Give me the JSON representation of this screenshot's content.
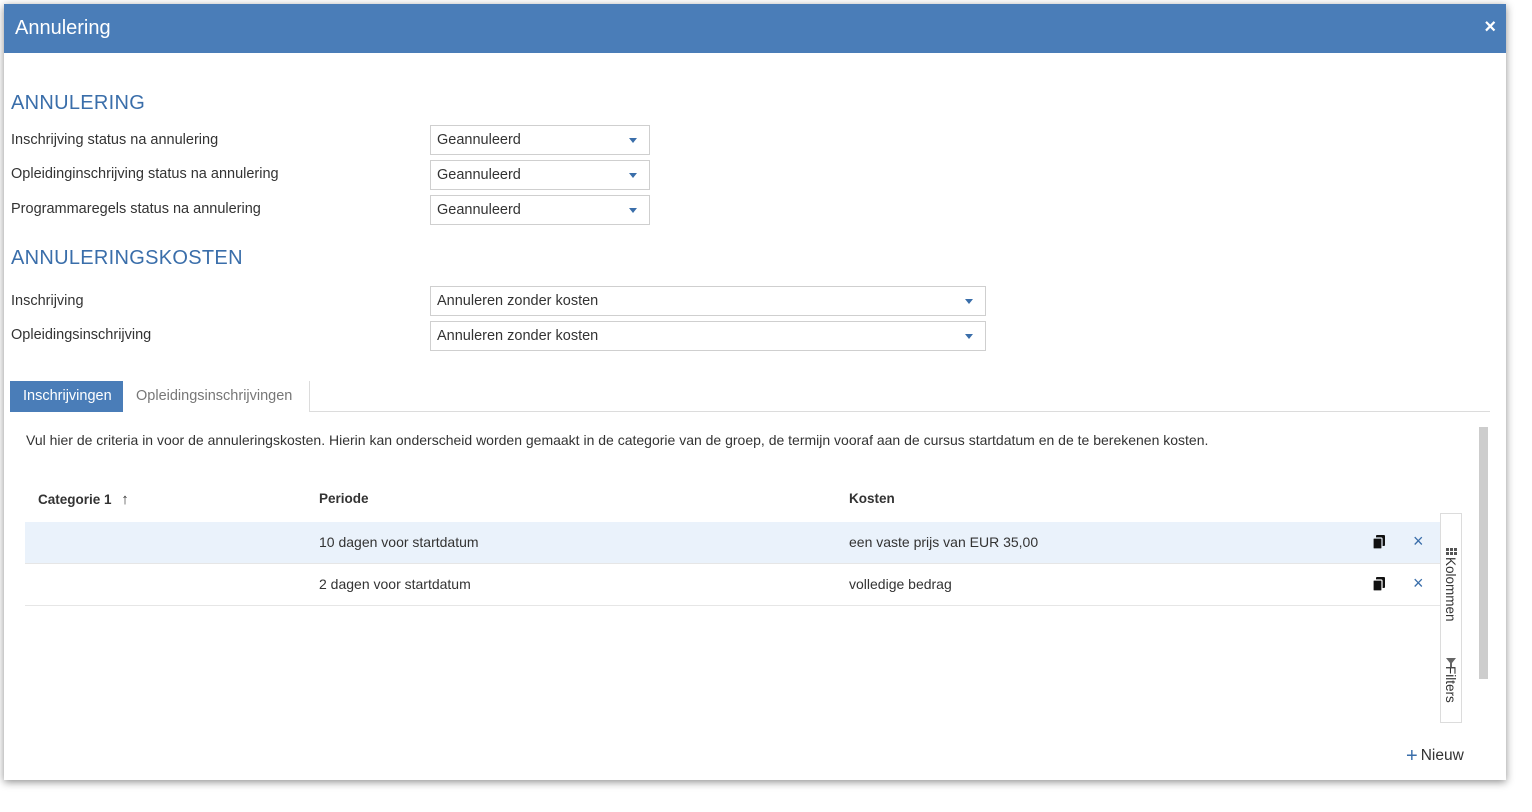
{
  "dialog": {
    "title": "Annulering",
    "close_symbol": "×"
  },
  "annulering": {
    "heading": "ANNULERING",
    "fields": [
      {
        "label": "Inschrijving status na annulering",
        "value": "Geannuleerd"
      },
      {
        "label": "Opleidinginschrijving status na annulering",
        "value": "Geannuleerd"
      },
      {
        "label": "Programmaregels status na annulering",
        "value": "Geannuleerd"
      }
    ]
  },
  "kosten": {
    "heading": "ANNULERINGSKOSTEN",
    "fields": [
      {
        "label": "Inschrijving",
        "value": "Annuleren zonder kosten"
      },
      {
        "label": "Opleidingsinschrijving",
        "value": "Annuleren zonder kosten"
      }
    ]
  },
  "tabs": [
    {
      "label": "Inschrijvingen",
      "active": true
    },
    {
      "label": "Opleidingsinschrijvingen",
      "active": false
    }
  ],
  "description": "Vul hier de criteria in voor de annuleringskosten. Hierin kan onderscheid worden gemaakt in de categorie van de groep, de termijn vooraf aan de cursus startdatum en de te berekenen kosten.",
  "grid": {
    "columns": [
      "Categorie 1",
      "Periode",
      "Kosten"
    ],
    "sort_indicator": "↑",
    "rows": [
      {
        "categorie": "",
        "periode": "10 dagen voor startdatum",
        "kosten": "een vaste prijs van EUR 35,00"
      },
      {
        "categorie": "",
        "periode": "2 dagen voor startdatum",
        "kosten": "volledige bedrag"
      }
    ],
    "remove_symbol": "×"
  },
  "side_panel": {
    "columns_label": "Kolommen",
    "filters_label": "Filters"
  },
  "new_button": {
    "symbol": "+",
    "label": "Nieuw"
  },
  "colors": {
    "accent": "#4a7db8",
    "heading": "#3a6eaa",
    "row_highlight": "#eaf2fb"
  },
  "icons": [
    "close-icon",
    "caret-down-icon",
    "sort-ascending-icon",
    "copy-icon",
    "remove-icon",
    "columns-icon",
    "filter-icon",
    "plus-icon"
  ]
}
